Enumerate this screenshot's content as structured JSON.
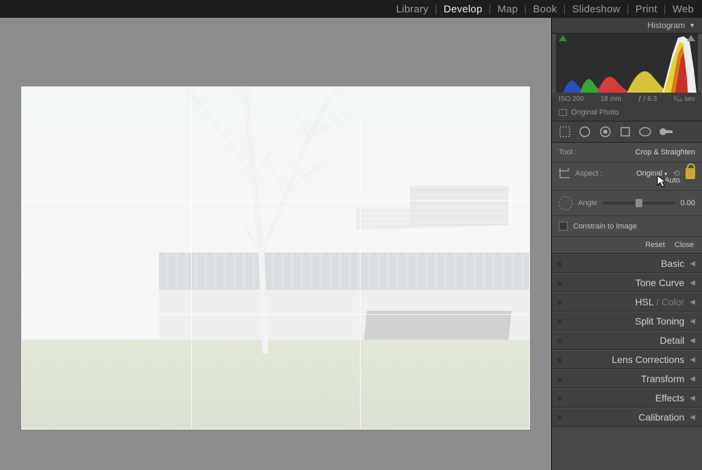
{
  "nav": {
    "library": "Library",
    "develop": "Develop",
    "map": "Map",
    "book": "Book",
    "slideshow": "Slideshow",
    "print": "Print",
    "web": "Web"
  },
  "histogram": {
    "title": "Histogram",
    "iso": "ISO 200",
    "focal": "18 mm",
    "aperture": "ƒ / 6.3",
    "shutter": "¹⁄₈₀ sec",
    "original": "Original Photo"
  },
  "tool": {
    "label": "Tool :",
    "name": "Crop & Straighten",
    "aspect_label": "Aspect :",
    "aspect_value": "Original",
    "auto": "Auto",
    "angle_label": "Angle",
    "angle_value": "0.00",
    "constrain": "Constrain to Image",
    "reset": "Reset",
    "close": "Close"
  },
  "panels": {
    "basic": "Basic",
    "tonecurve": "Tone Curve",
    "hsl": "HSL",
    "hsl_sep": " / ",
    "color": "Color",
    "split": "Split Toning",
    "detail": "Detail",
    "lens": "Lens Corrections",
    "transform": "Transform",
    "effects": "Effects",
    "calibration": "Calibration"
  }
}
